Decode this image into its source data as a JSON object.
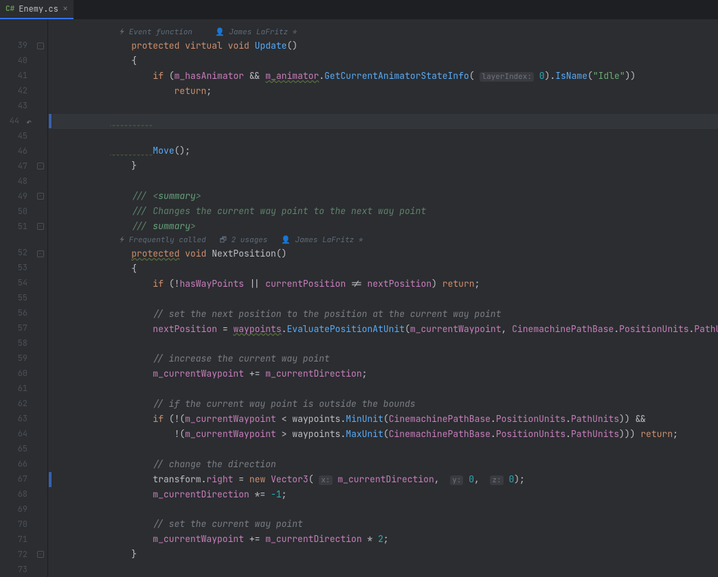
{
  "tab": {
    "filename": "Enemy.cs",
    "icon_label": "C#"
  },
  "anno": {
    "update": {
      "event": "Event function",
      "author": "James LaFritz *"
    },
    "next": {
      "freq": "Frequently called",
      "usages": "2 usages",
      "author": "James LaFritz *"
    }
  },
  "gutter": {
    "start": 39,
    "end": 73
  },
  "kw": {
    "protected": "protected",
    "virtual": "virtual",
    "void": "void",
    "if": "if",
    "return": "return",
    "new": "new"
  },
  "ident": {
    "Update": "Update",
    "NextPosition": "NextPosition",
    "m_hasAnimator": "m_hasAnimator",
    "m_animator": "m_animator",
    "GetCurrentAnimatorStateInfo": "GetCurrentAnimatorStateInfo",
    "IsName": "IsName",
    "Idle": "\"Idle\"",
    "Move": "Move",
    "hasWayPoints": "hasWayPoints",
    "currentPosition": "currentPosition",
    "nextPosition_p": "nextPosition",
    "nextPosition": "nextPosition",
    "waypoints": "waypoints",
    "EvaluatePositionAtUnit": "EvaluatePositionAtUnit",
    "m_currentWaypoint": "m_currentWaypoint",
    "CinemachinePathBase": "CinemachinePathBase",
    "PositionUnits": "PositionUnits",
    "PathUnits": "PathUnits",
    "m_currentDirection": "m_currentDirection",
    "MinUnit": "MinUnit",
    "MaxUnit": "MaxUnit",
    "transform": "transform",
    "right": "right",
    "Vector3": "Vector3"
  },
  "hints": {
    "layerIndex": "layerIndex:",
    "x": "x:",
    "y": "y:",
    "z": "z:"
  },
  "nums": {
    "zero": "0",
    "neg1": "-1",
    "two": "2"
  },
  "comments": {
    "summary_open": "/// <",
    "summary_tag": "summary",
    "summary_gt": ">",
    "summary_body": "/// Changes the current way point to the next way point",
    "summary_close": "/// </",
    "c1": "// set the next position to the position at the current way point",
    "c2": "// increase the current way point",
    "c3": "// if the current way point is outside the bounds",
    "c4": "// change the direction",
    "c5": "// set the current way point"
  }
}
